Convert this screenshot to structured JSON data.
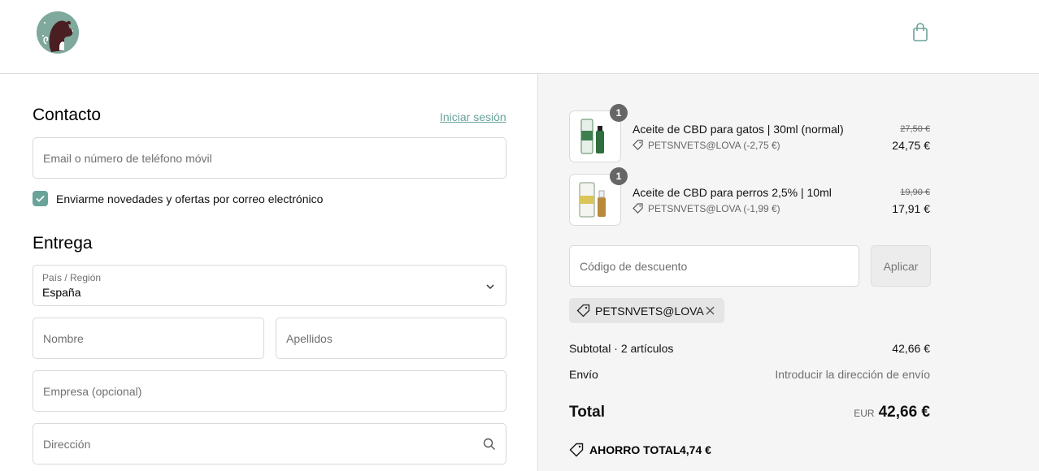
{
  "header": {
    "logo_icon": "dog-cat-logo-icon",
    "cart_icon": "shopping-bag-icon"
  },
  "contact": {
    "title": "Contacto",
    "login_link": "Iniciar sesión",
    "email_placeholder": "Email o número de teléfono móvil",
    "newsletter_checked": true,
    "newsletter_label": "Enviarme novedades y ofertas por correo electrónico"
  },
  "delivery": {
    "title": "Entrega",
    "country_label": "País / Región",
    "country_value": "España",
    "first_name_placeholder": "Nombre",
    "last_name_placeholder": "Apellidos",
    "company_placeholder": "Empresa (opcional)",
    "address_placeholder": "Dirección"
  },
  "summary": {
    "items": [
      {
        "quantity": "1",
        "name": "Aceite de CBD para gatos | 30ml (normal)",
        "discount": "PETSNVETS@LOVA (-2,75 €)",
        "old_price": "27,50 €",
        "price": "24,75 €"
      },
      {
        "quantity": "1",
        "name": "Aceite de CBD para perros 2,5% | 10ml",
        "discount": "PETSNVETS@LOVA (-1,99 €)",
        "old_price": "19,90 €",
        "price": "17,91 €"
      }
    ],
    "discount_placeholder": "Código de descuento",
    "apply_label": "Aplicar",
    "applied_code": "PETSNVETS@LOVA",
    "subtotal_label": "Subtotal · 2 artículos",
    "subtotal_value": "42,66 €",
    "shipping_label": "Envío",
    "shipping_value": "Introducir la dirección de envío",
    "total_label": "Total",
    "currency": "EUR",
    "total_value": "42,66 €",
    "savings_label": "AHORRO TOTAL",
    "savings_value": "4,74 €"
  },
  "colors": {
    "accent": "#6aa39a",
    "sidebar_bg": "#f5f5f5"
  }
}
